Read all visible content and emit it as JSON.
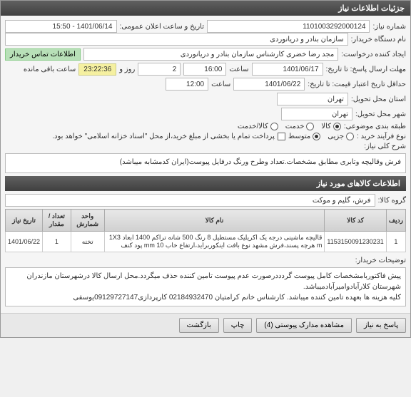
{
  "header": {
    "title": "جزئیات اطلاعات نیاز"
  },
  "form": {
    "need_number_label": "شماره نیاز:",
    "need_number": "1101003292000124",
    "announce_label": "تاریخ و ساعت اعلان عمومی:",
    "announce_value": "1401/06/14 - 15:50",
    "buyer_label": "نام دستگاه خریدار:",
    "buyer_value": "سازمان بنادر و دریانوردی",
    "requester_label": "ایجاد کننده درخواست:",
    "requester_value": "مجد رضا خضری کارشناس سازمان بنادر و دریانوردی",
    "contact_button": "اطلاعات تماس خریدار",
    "deadline_reply_label": "مهلت ارسال پاسخ: تا تاریخ:",
    "deadline_reply_date": "1401/06/17",
    "time_label": "ساعت",
    "deadline_reply_time": "16:00",
    "days_label": "روز و",
    "days_value": "2",
    "countdown": "23:22:36",
    "remaining_label": "ساعت باقی مانده",
    "validity_label": "حداقل تاریخ اعتبار قیمت: تا تاریخ:",
    "validity_date": "1401/06/22",
    "validity_time": "12:00",
    "province_label": "استان محل تحویل:",
    "province_value": "تهران",
    "city_label": "شهر محل تحویل:",
    "city_value": "تهران",
    "category_label": "طبقه بندی موضوعی:",
    "cat_goods": "کالا",
    "cat_service": "خدمت",
    "cat_goods_service": "کالا/خدمت",
    "process_label": "نوع فرآیند خرید :",
    "proc_small": "جزیی",
    "proc_medium": "متوسط",
    "payment_note": "پرداخت تمام یا بخشی از مبلغ خرید،از محل \"اسناد خزانه اسلامی\" خواهد بود.",
    "desc_label": "شرح کلی نیاز:",
    "desc_value": "فرش وقالیچه وتابری مطابق مشخصات.تعداد وطرح ورنگ درفایل پیوست(ایران کدمشابه میباشد)"
  },
  "items_section": {
    "title": "اطلاعات کالاهای مورد نیاز",
    "group_label": "گروه کالا:",
    "group_value": "فرش، گلیم و موکت"
  },
  "table": {
    "headers": {
      "row": "ردیف",
      "code": "کد کالا",
      "name": "نام کالا",
      "unit": "واحد شمارش",
      "qty": "تعداد / مقدار",
      "date": "تاریخ نیاز"
    },
    "rows": [
      {
        "row": "1",
        "code": "1153150091230231",
        "name": "قالیچه ماشینی درجه یک اکریلیک مستطیل 8 رنگ 500 شانه تراکم 1400 ابعاد 1X3 m هرچه پسند،فرش مشهد نوع بافت اینکوربراید،ارتفاع خاب 10 mm پود کنف",
        "unit": "تخته",
        "qty": "1",
        "date": "1401/06/22"
      }
    ]
  },
  "remarks": {
    "label": "توضیحات خریدار:",
    "value": "پیش فاکتوربامشخصات کامل پیوست گردددرصورت عدم پیوست تامین کننده حذف میگردد.محل ارسال کالا درشهرستان مازندران شهرستان کلارآبادوامیرآبادمیباشد.\nکلیه هزینه ها بعهده تامین کننده میباشد. کارشناس خانم کرامتیان 02184932470 کارپردازی09129727147یوسفی"
  },
  "buttons": {
    "reply": "پاسخ به نیاز",
    "attachments": "مشاهده مدارک پیوستی (4)",
    "print": "چاپ",
    "back": "بازگشت"
  }
}
